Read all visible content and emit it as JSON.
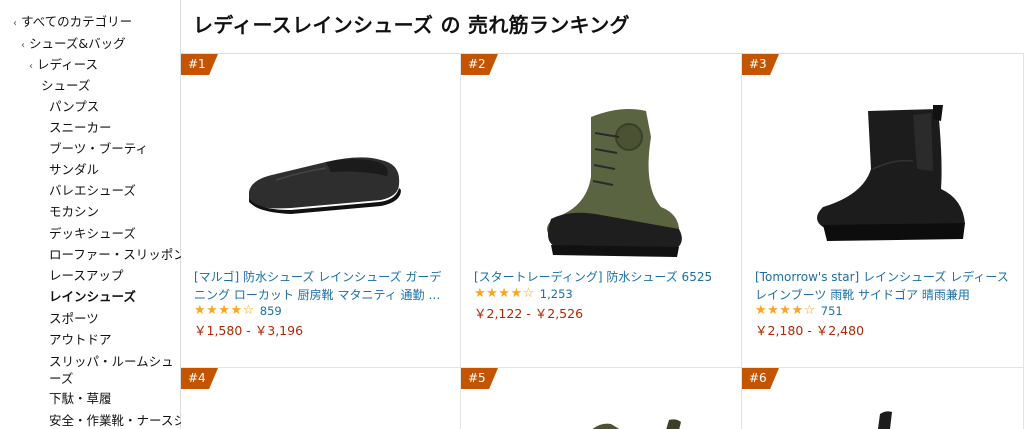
{
  "page_title": "レディースレインシューズ の 売れ筋ランキング",
  "sidebar": {
    "items": [
      {
        "label": "すべてのカテゴリー",
        "chevron": "‹"
      },
      {
        "label": "シューズ&バッグ",
        "chevron": "‹"
      },
      {
        "label": "レディース",
        "chevron": "‹"
      },
      {
        "label": "シューズ"
      },
      {
        "label": "パンプス"
      },
      {
        "label": "スニーカー"
      },
      {
        "label": "ブーツ・ブーティ"
      },
      {
        "label": "サンダル"
      },
      {
        "label": "バレエシューズ"
      },
      {
        "label": "モカシン"
      },
      {
        "label": "デッキシューズ"
      },
      {
        "label": "ローファー・スリッポン"
      },
      {
        "label": "レースアップ"
      },
      {
        "label": "レインシューズ",
        "selected": true
      },
      {
        "label": "スポーツ"
      },
      {
        "label": "アウトドア"
      },
      {
        "label": "スリッパ・ルームシューズ"
      },
      {
        "label": "下駄・草履"
      },
      {
        "label": "安全・作業靴・ナースシ"
      }
    ]
  },
  "products": [
    {
      "rank": "#1",
      "title": "[マルゴ] 防水シューズ レインシューズ ガーデニング ローカット 厨房靴 マタニティ 通勤 通学...",
      "stars": "★★★★☆",
      "reviews": "859",
      "price": "￥1,580 - ￥3,196",
      "icon": "slip-on-shoe-image"
    },
    {
      "rank": "#2",
      "title": "[スタートレーディング] 防水シューズ 6525",
      "stars": "★★★★☆",
      "reviews": "1,253",
      "price": "￥2,122 - ￥2,526",
      "icon": "lace-up-boot-image"
    },
    {
      "rank": "#3",
      "title": "[Tomorrow's star] レインシューズ レディース レインブーツ 雨靴 サイドゴア 晴雨兼用",
      "stars": "★★★★☆",
      "reviews": "751",
      "price": "￥2,180 - ￥2,480",
      "icon": "chelsea-boot-image"
    },
    {
      "rank": "#4"
    },
    {
      "rank": "#5"
    },
    {
      "rank": "#6"
    }
  ],
  "colors": {
    "accent_badge": "#c45500",
    "link": "#1a6fa6",
    "price": "#b12704",
    "star": "#ffa41c"
  }
}
